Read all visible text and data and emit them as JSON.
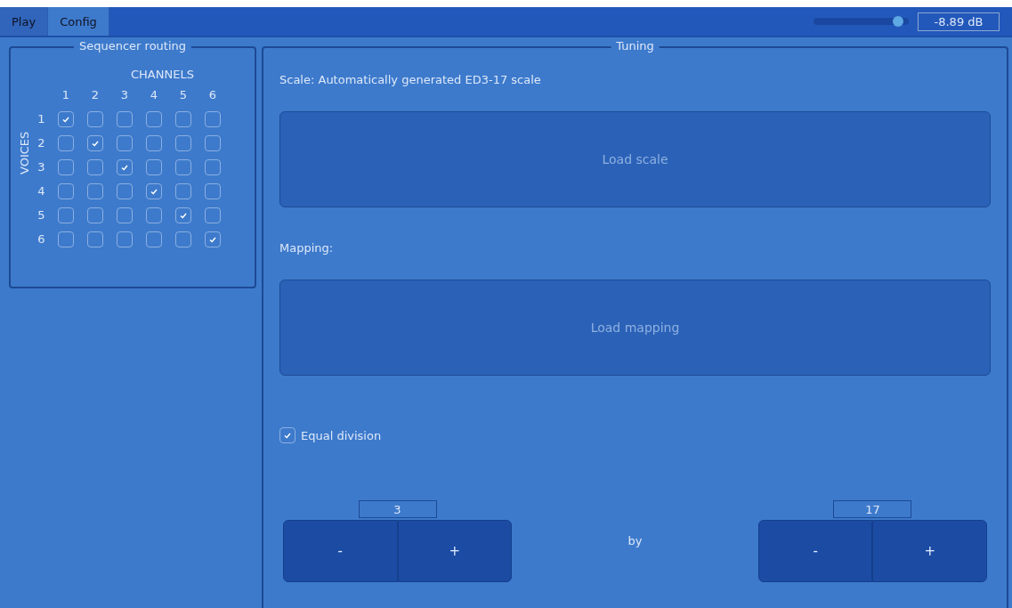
{
  "tabs": [
    {
      "label": "Play",
      "selected": false
    },
    {
      "label": "Config",
      "selected": true
    }
  ],
  "volume": {
    "reading": "-8.89 dB"
  },
  "routing": {
    "title": "Sequencer routing",
    "channels_label": "CHANNELS",
    "voices_label": "VOICES",
    "columns": [
      "1",
      "2",
      "3",
      "4",
      "5",
      "6"
    ],
    "rows": [
      {
        "label": "1",
        "cells": [
          {
            "checked": true
          },
          {
            "checked": false
          },
          {
            "checked": false
          },
          {
            "checked": false
          },
          {
            "checked": false
          },
          {
            "checked": false
          }
        ]
      },
      {
        "label": "2",
        "cells": [
          {
            "checked": false
          },
          {
            "checked": true
          },
          {
            "checked": false
          },
          {
            "checked": false
          },
          {
            "checked": false
          },
          {
            "checked": false
          }
        ]
      },
      {
        "label": "3",
        "cells": [
          {
            "checked": false
          },
          {
            "checked": false
          },
          {
            "checked": true
          },
          {
            "checked": false
          },
          {
            "checked": false
          },
          {
            "checked": false
          }
        ]
      },
      {
        "label": "4",
        "cells": [
          {
            "checked": false
          },
          {
            "checked": false
          },
          {
            "checked": false
          },
          {
            "checked": true
          },
          {
            "checked": false
          },
          {
            "checked": false
          }
        ]
      },
      {
        "label": "5",
        "cells": [
          {
            "checked": false
          },
          {
            "checked": false
          },
          {
            "checked": false
          },
          {
            "checked": false
          },
          {
            "checked": true
          },
          {
            "checked": false
          }
        ]
      },
      {
        "label": "6",
        "cells": [
          {
            "checked": false
          },
          {
            "checked": false
          },
          {
            "checked": false
          },
          {
            "checked": false
          },
          {
            "checked": false
          },
          {
            "checked": true
          }
        ]
      }
    ]
  },
  "tuning": {
    "title": "Tuning",
    "scale_text": "Scale: Automatically generated ED3-17 scale",
    "load_scale": "Load scale",
    "mapping_label": "Mapping:",
    "load_mapping": "Load mapping",
    "equal_division": {
      "label": "Equal division",
      "checked": true
    },
    "steppers": [
      {
        "value": "3",
        "minus": "-",
        "plus": "+"
      },
      {
        "value": "17",
        "minus": "-",
        "plus": "+"
      }
    ],
    "by": "by"
  }
}
